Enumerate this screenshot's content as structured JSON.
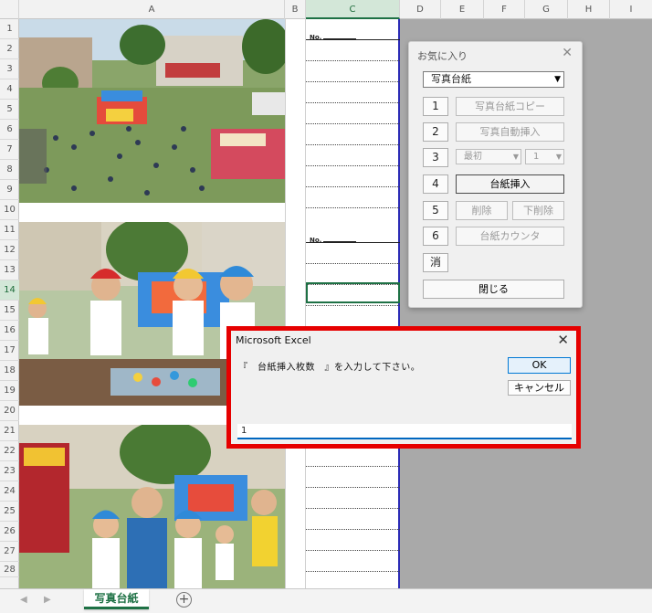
{
  "columns": [
    "A",
    "B",
    "C",
    "D",
    "E",
    "F",
    "G",
    "H",
    "I"
  ],
  "rows": [
    "1",
    "2",
    "3",
    "4",
    "5",
    "6",
    "7",
    "8",
    "9",
    "10",
    "11",
    "12",
    "13",
    "14",
    "15",
    "16",
    "17",
    "18",
    "19",
    "20",
    "21",
    "22",
    "23",
    "24",
    "25",
    "26",
    "27",
    "28"
  ],
  "sheet": {
    "no_label": "No.",
    "tab_label": "写真台紙"
  },
  "favorites": {
    "title": "お気に入り",
    "close_x": "✕",
    "dropdown_value": "写真台紙",
    "num1": "1",
    "btn1": "写真台紙コピー",
    "num2": "2",
    "btn2": "写真自動挿入",
    "num3": "3",
    "sel3a": "最初",
    "sel3b": "1",
    "num4": "4",
    "btn4": "台紙挿入",
    "num5": "5",
    "btn5a": "削除",
    "btn5b": "下削除",
    "num6": "6",
    "btn6": "台紙カウンタ",
    "clear": "消",
    "close_label": "閉じる"
  },
  "dialog": {
    "title": "Microsoft Excel",
    "close_x": "✕",
    "message": "『　台紙挿入枚数　』を入力して下さい。",
    "ok": "OK",
    "cancel": "キャンセル",
    "input_value": "1"
  },
  "colors": {
    "accent_green": "#1e7145",
    "highlight_red": "#e60000",
    "border_blue": "#2b2bb5"
  }
}
